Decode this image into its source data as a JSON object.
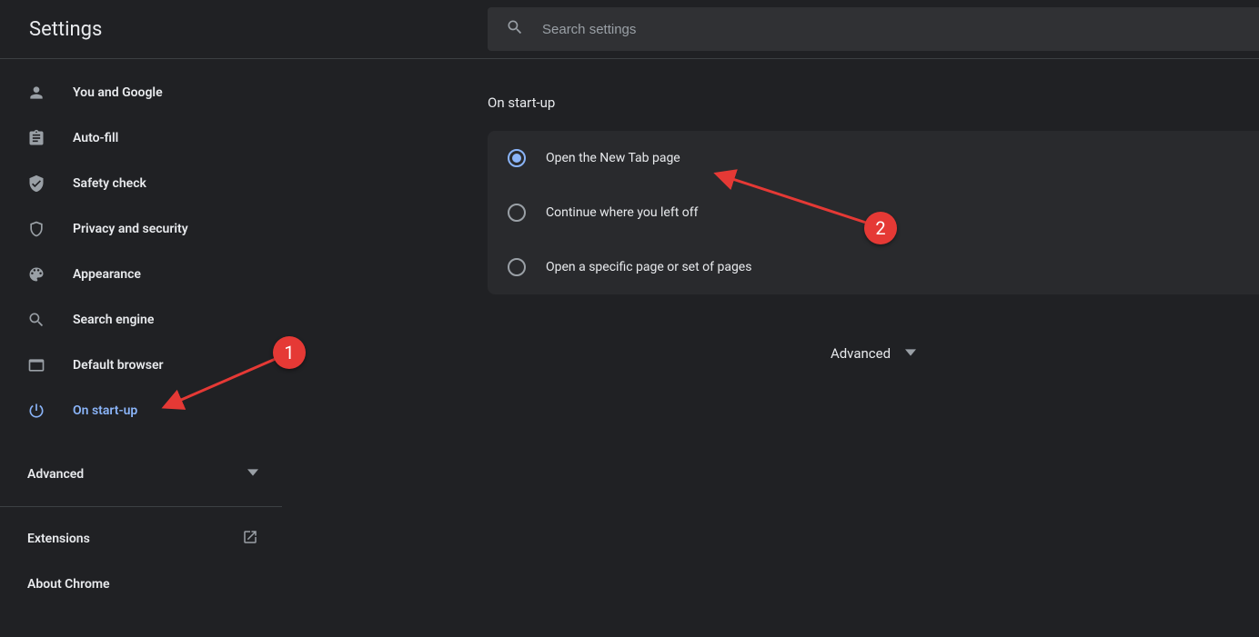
{
  "header": {
    "title": "Settings",
    "search_placeholder": "Search settings"
  },
  "sidebar": {
    "items": [
      {
        "label": "You and Google"
      },
      {
        "label": "Auto-fill"
      },
      {
        "label": "Safety check"
      },
      {
        "label": "Privacy and security"
      },
      {
        "label": "Appearance"
      },
      {
        "label": "Search engine"
      },
      {
        "label": "Default browser"
      },
      {
        "label": "On start-up"
      }
    ],
    "advanced_label": "Advanced",
    "extensions_label": "Extensions",
    "about_label": "About Chrome"
  },
  "main": {
    "section_title": "On start-up",
    "options": [
      {
        "label": "Open the New Tab page"
      },
      {
        "label": "Continue where you left off"
      },
      {
        "label": "Open a specific page or set of pages"
      }
    ],
    "advanced_label": "Advanced"
  },
  "annotations": {
    "one": "1",
    "two": "2"
  }
}
